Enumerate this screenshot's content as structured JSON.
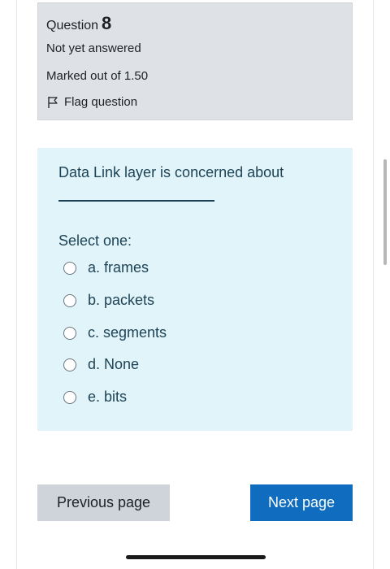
{
  "question": {
    "label": "Question",
    "number": "8",
    "status": "Not yet answered",
    "marks": "Marked out of 1.50",
    "flag_label": "Flag question",
    "flag_icon": "flag-outline-icon"
  },
  "content": {
    "question_text": "Data Link layer is concerned about",
    "prompt": "Select one:",
    "options": [
      {
        "label": "a. frames",
        "selected": false
      },
      {
        "label": "b. packets",
        "selected": false
      },
      {
        "label": "c. segments",
        "selected": false
      },
      {
        "label": "d. None",
        "selected": false
      },
      {
        "label": "e. bits",
        "selected": false
      }
    ]
  },
  "navigation": {
    "previous_label": "Previous page",
    "next_label": "Next page"
  },
  "colors": {
    "info_background": "#dee2e6",
    "content_background": "#e1f4f9",
    "text_dark_blue": "#1e4356",
    "next_button": "#0f6cbf",
    "previous_button": "#ced4da"
  }
}
